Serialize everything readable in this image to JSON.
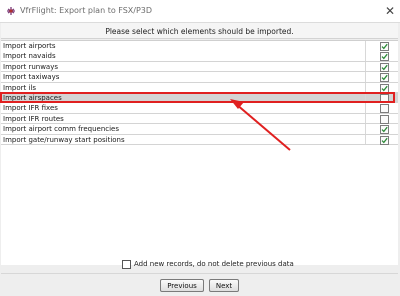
{
  "window": {
    "title": "VfrFlight: Export plan to FSX/P3D",
    "icon": "vfrflight-app-icon",
    "close_glyph": "✕"
  },
  "header": {
    "instruction": "Please select which elements should be imported."
  },
  "rows": [
    {
      "label": "Import airports",
      "checked": true,
      "selected": false
    },
    {
      "label": "Import navaids",
      "checked": true,
      "selected": false
    },
    {
      "label": "Import runways",
      "checked": true,
      "selected": false
    },
    {
      "label": "Import taxiways",
      "checked": true,
      "selected": false
    },
    {
      "label": "Import ils",
      "checked": true,
      "selected": false
    },
    {
      "label": "Import airspaces",
      "checked": false,
      "selected": true
    },
    {
      "label": "Import IFR fixes",
      "checked": false,
      "selected": false
    },
    {
      "label": "Import IFR routes",
      "checked": false,
      "selected": false
    },
    {
      "label": "Import airport comm frequencies",
      "checked": true,
      "selected": false
    },
    {
      "label": "Import gate/runway start positions",
      "checked": true,
      "selected": false
    }
  ],
  "footer": {
    "keep_records_label": "Add new records, do not delete previous data",
    "keep_records_checked": false,
    "previous_label": "Previous",
    "next_label": "Next"
  },
  "colors": {
    "check": "#2e8b3a",
    "annotation": "#e02020",
    "selected_row": "#d4d4d4"
  }
}
